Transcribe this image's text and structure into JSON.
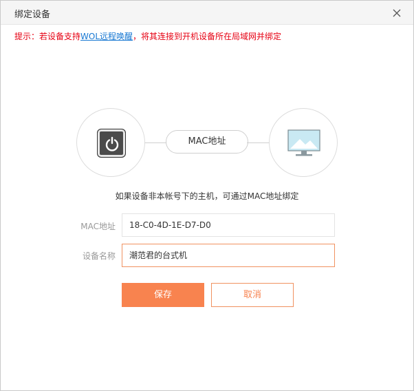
{
  "dialog": {
    "title": "绑定设备",
    "close_icon": "close-icon"
  },
  "tip": {
    "prefix": "提示：若设备支持",
    "link": "WOL远程唤醒",
    "suffix": "，将其连接到开机设备所在局域网并绑定"
  },
  "diagram": {
    "left_icon": "power-icon",
    "right_icon": "monitor-icon",
    "pill_label": "MAC地址"
  },
  "description": "如果设备非本帐号下的主机，可通过MAC地址绑定",
  "form": {
    "mac_label": "MAC地址",
    "mac_value": "18-C0-4D-1E-D7-D0",
    "name_label": "设备名称",
    "name_value": "潮范君的台式机"
  },
  "buttons": {
    "save": "保存",
    "cancel": "取消"
  },
  "colors": {
    "accent": "#f8834f",
    "tip": "#e60012",
    "link": "#1677d2"
  }
}
